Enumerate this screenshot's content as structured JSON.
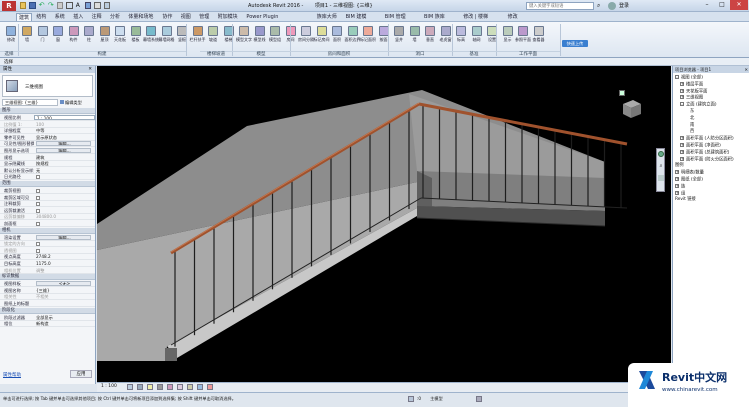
{
  "title_bar": {
    "app_title": "Autodesk Revit 2016 -",
    "doc_title": "项目1 - 三维视图: {三维}",
    "search_placeholder": "键入关键字或短语",
    "user": "登录"
  },
  "menu_tabs": [
    "建筑",
    "结构",
    "系统",
    "插入",
    "注释",
    "分析",
    "体量和场地",
    "协作",
    "视图",
    "管理",
    "附加模块",
    "Power Plugin",
    "族库大师",
    "BIM 建模",
    "BIM 管理",
    "BIM 族库",
    "修改 | 楼梯",
    "修改"
  ],
  "active_tab": "建筑",
  "ribbon": {
    "select_label": "选择",
    "buttons": [
      {
        "label": "修改",
        "icon": "cursor-icon"
      },
      {
        "label": "墙",
        "icon": "wall-icon"
      },
      {
        "label": "门",
        "icon": "door-icon"
      },
      {
        "label": "窗",
        "icon": "window-icon"
      },
      {
        "label": "构件",
        "icon": "component-icon"
      },
      {
        "label": "柱",
        "icon": "column-icon"
      },
      {
        "label": "屋顶",
        "icon": "roof-icon"
      },
      {
        "label": "天花板",
        "icon": "ceiling-icon"
      },
      {
        "label": "楼板",
        "icon": "floor-icon"
      },
      {
        "label": "幕墙系统",
        "icon": "curtain-system-icon"
      },
      {
        "label": "幕墙网格",
        "icon": "curtain-grid-icon"
      },
      {
        "label": "竖梃",
        "icon": "mullion-icon"
      },
      {
        "label": "栏杆扶手",
        "icon": "railing-icon"
      },
      {
        "label": "坡道",
        "icon": "ramp-icon"
      },
      {
        "label": "楼梯",
        "icon": "stair-icon"
      },
      {
        "label": "模型文字",
        "icon": "model-text-icon"
      },
      {
        "label": "模型线",
        "icon": "model-line-icon"
      },
      {
        "label": "模型组",
        "icon": "model-group-icon"
      },
      {
        "label": "房间",
        "icon": "room-icon"
      },
      {
        "label": "房间分隔",
        "icon": "room-separator-icon"
      },
      {
        "label": "标记房间",
        "icon": "tag-room-icon"
      },
      {
        "label": "面积",
        "icon": "area-icon"
      },
      {
        "label": "面积边界",
        "icon": "area-boundary-icon"
      },
      {
        "label": "标记面积",
        "icon": "tag-area-icon"
      },
      {
        "label": "按面",
        "icon": "by-face-icon"
      },
      {
        "label": "竖井",
        "icon": "shaft-icon"
      },
      {
        "label": "墙",
        "icon": "opening-wall-icon"
      },
      {
        "label": "垂直",
        "icon": "vertical-icon"
      },
      {
        "label": "老虎窗",
        "icon": "dormer-icon"
      },
      {
        "label": "标高",
        "icon": "level-icon"
      },
      {
        "label": "轴网",
        "icon": "grid-icon"
      },
      {
        "label": "设置",
        "icon": "set-icon"
      },
      {
        "label": "显示",
        "icon": "show-icon"
      },
      {
        "label": "参照平面",
        "icon": "ref-plane-icon"
      },
      {
        "label": "查看器",
        "icon": "viewer-icon"
      }
    ],
    "groups": [
      "选择",
      "构建",
      "楼梯坡道",
      "模型",
      "房间和面积",
      "洞口",
      "基准",
      "工作平面"
    ],
    "highlight_button": "快速上传"
  },
  "properties": {
    "header": "属性",
    "type_name": "三维视图",
    "view_selector": "三维视图: {三维}",
    "edit_type": "编辑类型",
    "sections": [
      {
        "title": "图形",
        "rows": [
          {
            "k": "视图比例",
            "v": "1 : 100",
            "type": "input"
          },
          {
            "k": "比例值 1:",
            "v": "100",
            "type": "grey"
          },
          {
            "k": "详细程度",
            "v": "中等",
            "type": "text"
          },
          {
            "k": "零件可见性",
            "v": "显示原状态",
            "type": "text"
          },
          {
            "k": "可见性/图形替换",
            "v": "编辑...",
            "type": "btn"
          },
          {
            "k": "图形显示选项",
            "v": "编辑...",
            "type": "btn"
          },
          {
            "k": "规程",
            "v": "建筑",
            "type": "text"
          },
          {
            "k": "显示隐藏线",
            "v": "按规程",
            "type": "text"
          },
          {
            "k": "默认分析显示样式",
            "v": "无",
            "type": "text"
          },
          {
            "k": "日光路径",
            "v": "",
            "type": "check"
          }
        ]
      },
      {
        "title": "范围",
        "rows": [
          {
            "k": "裁剪视图",
            "v": "",
            "type": "check"
          },
          {
            "k": "裁剪区域可见",
            "v": "",
            "type": "check"
          },
          {
            "k": "注释裁剪",
            "v": "",
            "type": "check"
          },
          {
            "k": "远剪裁激活",
            "v": "",
            "type": "check"
          },
          {
            "k": "远剪裁偏移",
            "v": "304800.0",
            "type": "grey"
          },
          {
            "k": "剖面框",
            "v": "",
            "type": "check"
          }
        ]
      },
      {
        "title": "相机",
        "rows": [
          {
            "k": "渲染设置",
            "v": "编辑...",
            "type": "btn"
          },
          {
            "k": "锁定的方向",
            "v": "",
            "type": "greycheck"
          },
          {
            "k": "透视图",
            "v": "",
            "type": "greycheck"
          },
          {
            "k": "视点高度",
            "v": "2748.2",
            "type": "text"
          },
          {
            "k": "目标高度",
            "v": "1175.0",
            "type": "text"
          },
          {
            "k": "相机位置",
            "v": "调整",
            "type": "grey"
          }
        ]
      },
      {
        "title": "标识数据",
        "rows": [
          {
            "k": "视图样板",
            "v": "<无>",
            "type": "btn"
          },
          {
            "k": "视图名称",
            "v": "{三维}",
            "type": "text"
          },
          {
            "k": "相关性",
            "v": "不相关",
            "type": "grey"
          },
          {
            "k": "图纸上的标题",
            "v": "",
            "type": "text"
          }
        ]
      },
      {
        "title": "阶段化",
        "rows": [
          {
            "k": "阶段过滤器",
            "v": "全部显示",
            "type": "text"
          },
          {
            "k": "相位",
            "v": "新构造",
            "type": "text"
          }
        ]
      }
    ],
    "help_link": "属性帮助",
    "apply": "应用"
  },
  "project_browser": {
    "header": "项目浏览器 - 项目1",
    "items": [
      {
        "label": "视图 (全部)",
        "level": 0,
        "ex": "-"
      },
      {
        "label": "楼层平面",
        "level": 1,
        "ex": "+"
      },
      {
        "label": "天花板平面",
        "level": 1,
        "ex": "+"
      },
      {
        "label": "三维视图",
        "level": 1,
        "ex": "+"
      },
      {
        "label": "立面 (建筑立面)",
        "level": 1,
        "ex": "-"
      },
      {
        "label": "东",
        "level": 3,
        "ex": ""
      },
      {
        "label": "北",
        "level": 3,
        "ex": ""
      },
      {
        "label": "南",
        "level": 3,
        "ex": ""
      },
      {
        "label": "西",
        "level": 3,
        "ex": ""
      },
      {
        "label": "面积平面 (人防分区面积)",
        "level": 1,
        "ex": "+"
      },
      {
        "label": "面积平面 (净面积)",
        "level": 1,
        "ex": "+"
      },
      {
        "label": "面积平面 (总建筑面积)",
        "level": 1,
        "ex": "+"
      },
      {
        "label": "面积平面 (防火分区面积)",
        "level": 1,
        "ex": "+"
      },
      {
        "label": "图例",
        "level": 0,
        "ex": ""
      },
      {
        "label": "明细表/数量",
        "level": 0,
        "ex": "+"
      },
      {
        "label": "图纸 (全部)",
        "level": 0,
        "ex": "+"
      },
      {
        "label": "族",
        "level": 0,
        "ex": "+"
      },
      {
        "label": "组",
        "level": 0,
        "ex": "+"
      },
      {
        "label": "Revit 链接",
        "level": 0,
        "ex": ""
      }
    ]
  },
  "view_bar": {
    "scale": "1 : 100"
  },
  "status_bar": {
    "text": "单击可进行选择; 按 Tab 键并单击可选择其他项目; 按 Ctrl 键并单击可将新项目添加到选择集; 按 Shift 键并单击可取消选择。",
    "coord": ":0",
    "model": "主模型"
  },
  "watermark": {
    "brand": "Revit中文网",
    "url": "www.chinarevit.com"
  },
  "colors": {
    "railing_top": "#a0522d",
    "ribbon_bg": "#e4ebf4",
    "viewport": "#000000"
  }
}
